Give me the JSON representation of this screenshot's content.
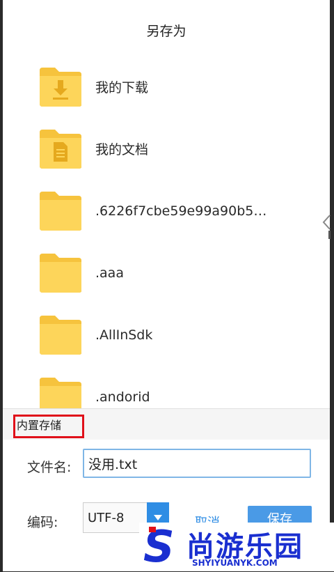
{
  "dialog": {
    "title": "另存为"
  },
  "folders": [
    {
      "name": "我的下载",
      "icon": "download-folder-icon"
    },
    {
      "name": "我的文档",
      "icon": "document-folder-icon"
    },
    {
      "name": ".6226f7cbe59e99a90b5…",
      "icon": "folder-icon"
    },
    {
      "name": ".aaa",
      "icon": "folder-icon"
    },
    {
      "name": ".AllInSdk",
      "icon": "folder-icon"
    },
    {
      "name": ".andorid",
      "icon": "folder-icon"
    }
  ],
  "breadcrumb": {
    "path": "内置存储",
    "highlight_color": "#e0101a"
  },
  "form": {
    "filename_label": "文件名:",
    "filename_value": "没用.txt",
    "encoding_label": "编码:",
    "encoding_value": "UTF-8",
    "cancel_label": "取消",
    "save_label": "保存"
  },
  "colors": {
    "folder": "#fdd55a",
    "folder_tab": "#f6c33d",
    "accent": "#2f8de4"
  },
  "watermark": {
    "letter": "S",
    "text": "尚游乐园",
    "url": "SHYIYUANYK.COM"
  }
}
